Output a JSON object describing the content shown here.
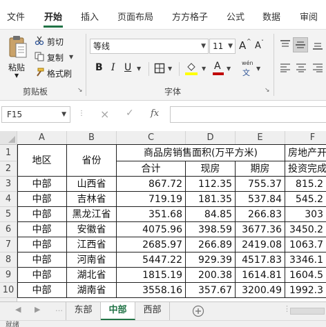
{
  "ribbon_tabs": [
    {
      "label": "文件",
      "active": false
    },
    {
      "label": "开始",
      "active": true
    },
    {
      "label": "插入",
      "active": false
    },
    {
      "label": "页面布局",
      "active": false
    },
    {
      "label": "方方格子",
      "active": false
    },
    {
      "label": "公式",
      "active": false
    },
    {
      "label": "数据",
      "active": false
    },
    {
      "label": "审阅",
      "active": false
    }
  ],
  "clipboard": {
    "paste_label": "粘贴",
    "cut_label": "剪切",
    "copy_label": "复制",
    "format_painter_label": "格式刷",
    "group_label": "剪贴板"
  },
  "font": {
    "font_name": "等线",
    "font_size": "11",
    "grow_label": "A",
    "shrink_label": "A",
    "bold_label": "B",
    "italic_label": "I",
    "underline_label": "U",
    "fill_label": "A",
    "font_color_label": "A",
    "phonetic_top": "wén",
    "phonetic_bottom": "文",
    "group_label": "字体"
  },
  "formula_bar": {
    "name_box": "F15",
    "cancel_icon_label": "×",
    "enter_icon_label": "✓",
    "fx_label": "fx",
    "formula_value": ""
  },
  "grid": {
    "columns": [
      "A",
      "B",
      "C",
      "D",
      "E",
      "F"
    ],
    "rows": [
      "1",
      "2",
      "3",
      "4",
      "5",
      "6",
      "7",
      "8",
      "9",
      "10"
    ],
    "header": {
      "region": "地区",
      "province": "省份",
      "sales_area": "商品房销售面积(万平方米)",
      "total": "合计",
      "spot": "现房",
      "futures": "期房",
      "invest_line1": "房地产开",
      "invest_line2": "投资完成"
    },
    "data_rows": [
      {
        "region": "中部",
        "province": "山西省",
        "total": "867.72",
        "spot": "112.35",
        "futures": "755.37",
        "invest": "815.2"
      },
      {
        "region": "中部",
        "province": "吉林省",
        "total": "719.19",
        "spot": "181.35",
        "futures": "537.84",
        "invest": "545.2"
      },
      {
        "region": "中部",
        "province": "黑龙江省",
        "total": "351.68",
        "spot": "84.85",
        "futures": "266.83",
        "invest": "303"
      },
      {
        "region": "中部",
        "province": "安徽省",
        "total": "4075.96",
        "spot": "398.59",
        "futures": "3677.36",
        "invest": "3450.2"
      },
      {
        "region": "中部",
        "province": "江西省",
        "total": "2685.97",
        "spot": "266.89",
        "futures": "2419.08",
        "invest": "1063.7"
      },
      {
        "region": "中部",
        "province": "河南省",
        "total": "5447.22",
        "spot": "929.39",
        "futures": "4517.83",
        "invest": "3346.1"
      },
      {
        "region": "中部",
        "province": "湖北省",
        "total": "1815.19",
        "spot": "200.38",
        "futures": "1614.81",
        "invest": "1604.5"
      },
      {
        "region": "中部",
        "province": "湖南省",
        "total": "3558.16",
        "spot": "357.67",
        "futures": "3200.49",
        "invest": "1992.3"
      }
    ]
  },
  "sheet_tabs": [
    {
      "label": "东部",
      "active": false
    },
    {
      "label": "中部",
      "active": true
    },
    {
      "label": "西部",
      "active": false
    }
  ],
  "status": {
    "ready_label": "就绪"
  },
  "colors": {
    "accent": "#217346",
    "grid_border": "#1f1f1f",
    "header_bg": "#efefef"
  }
}
